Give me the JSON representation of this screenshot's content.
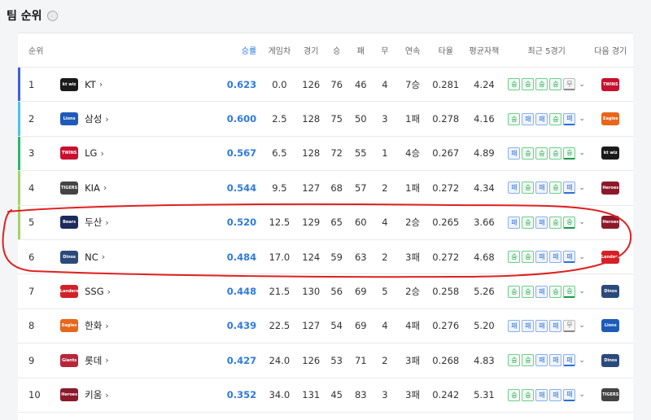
{
  "header": {
    "title": "팀 순위",
    "info_icon": "ⓘ"
  },
  "columns": [
    "순위",
    "",
    "승률",
    "게임차",
    "경기",
    "승",
    "패",
    "무",
    "연속",
    "타율",
    "평균자책",
    "최근 5경기",
    "다음 경기"
  ],
  "result_labels": {
    "W": "승",
    "L": "패",
    "D": "무"
  },
  "colors": {
    "accent": "#2e7ae0",
    "win": "#1b9a49",
    "loss": "#2e6fd8",
    "annotation": "#e02020"
  },
  "rows": [
    {
      "rank": "1",
      "team": "KT",
      "pct": "0.623",
      "gb": "0.0",
      "g": "126",
      "w": "76",
      "l": "46",
      "d": "4",
      "streak": "7승",
      "avg": "0.281",
      "era": "4.24",
      "recent": [
        "W",
        "W",
        "W",
        "W",
        "D"
      ],
      "next": "TWINS",
      "bar": "#3f5fd9",
      "logo_text": "kt wiz",
      "logo_color": "#1a1a1a",
      "next_color": "#c8102e"
    },
    {
      "rank": "2",
      "team": "삼성",
      "pct": "0.600",
      "gb": "2.5",
      "g": "128",
      "w": "75",
      "l": "50",
      "d": "3",
      "streak": "1패",
      "avg": "0.278",
      "era": "4.16",
      "recent": [
        "W",
        "L",
        "L",
        "W",
        "L"
      ],
      "next": "Eagles",
      "bar": "#4fc3e0",
      "logo_text": "Lions",
      "logo_color": "#1e5bb8",
      "next_color": "#e8661c"
    },
    {
      "rank": "3",
      "team": "LG",
      "pct": "0.567",
      "gb": "6.5",
      "g": "128",
      "w": "72",
      "l": "55",
      "d": "1",
      "streak": "4승",
      "avg": "0.267",
      "era": "4.89",
      "recent": [
        "L",
        "W",
        "W",
        "W",
        "W"
      ],
      "next": "kt wiz",
      "bar": "#2bb86a",
      "logo_text": "TWINS",
      "logo_color": "#c8102e",
      "next_color": "#1a1a1a"
    },
    {
      "rank": "4",
      "team": "KIA",
      "pct": "0.544",
      "gb": "9.5",
      "g": "127",
      "w": "68",
      "l": "57",
      "d": "2",
      "streak": "1패",
      "avg": "0.272",
      "era": "4.34",
      "recent": [
        "L",
        "W",
        "L",
        "W",
        "L"
      ],
      "next": "Heroes",
      "bar": "#a0d56a",
      "logo_text": "TIGERS",
      "logo_color": "#444444",
      "next_color": "#8b1a2b"
    },
    {
      "rank": "5",
      "team": "두산",
      "pct": "0.520",
      "gb": "12.5",
      "g": "129",
      "w": "65",
      "l": "60",
      "d": "4",
      "streak": "2승",
      "avg": "0.265",
      "era": "3.66",
      "recent": [
        "L",
        "W",
        "L",
        "W",
        "W"
      ],
      "next": "Heroes",
      "bar": "#a0d56a",
      "logo_text": "Bears",
      "logo_color": "#1c2a5c",
      "next_color": "#8b1a2b"
    },
    {
      "rank": "6",
      "team": "NC",
      "pct": "0.484",
      "gb": "17.0",
      "g": "124",
      "w": "59",
      "l": "63",
      "d": "2",
      "streak": "3패",
      "avg": "0.272",
      "era": "4.68",
      "recent": [
        "W",
        "W",
        "L",
        "L",
        "L"
      ],
      "next": "Landers",
      "bar": "",
      "logo_text": "Dinos",
      "logo_color": "#2a4a7a",
      "next_color": "#d42027"
    },
    {
      "rank": "7",
      "team": "SSG",
      "pct": "0.448",
      "gb": "21.5",
      "g": "130",
      "w": "56",
      "l": "69",
      "d": "5",
      "streak": "2승",
      "avg": "0.258",
      "era": "5.26",
      "recent": [
        "W",
        "W",
        "L",
        "W",
        "W"
      ],
      "next": "Dinos",
      "bar": "",
      "logo_text": "Landers",
      "logo_color": "#d42027",
      "next_color": "#2a4a7a"
    },
    {
      "rank": "8",
      "team": "한화",
      "pct": "0.439",
      "gb": "22.5",
      "g": "127",
      "w": "54",
      "l": "69",
      "d": "4",
      "streak": "4패",
      "avg": "0.276",
      "era": "5.20",
      "recent": [
        "L",
        "L",
        "L",
        "L",
        "D"
      ],
      "next": "Lions",
      "bar": "",
      "logo_text": "Eagles",
      "logo_color": "#e8661c",
      "next_color": "#1e5bb8"
    },
    {
      "rank": "9",
      "team": "롯데",
      "pct": "0.427",
      "gb": "24.0",
      "g": "126",
      "w": "53",
      "l": "71",
      "d": "2",
      "streak": "3패",
      "avg": "0.268",
      "era": "4.83",
      "recent": [
        "W",
        "W",
        "L",
        "L",
        "L"
      ],
      "next": "Dinos",
      "bar": "",
      "logo_text": "Giants",
      "logo_color": "#b8263a",
      "next_color": "#2a4a7a"
    },
    {
      "rank": "10",
      "team": "키움",
      "pct": "0.352",
      "gb": "34.0",
      "g": "131",
      "w": "45",
      "l": "83",
      "d": "3",
      "streak": "3패",
      "avg": "0.242",
      "era": "5.31",
      "recent": [
        "W",
        "W",
        "L",
        "L",
        "L"
      ],
      "next": "TIGERS",
      "bar": "",
      "logo_text": "Heroes",
      "logo_color": "#8b1a2b",
      "next_color": "#444444"
    }
  ]
}
